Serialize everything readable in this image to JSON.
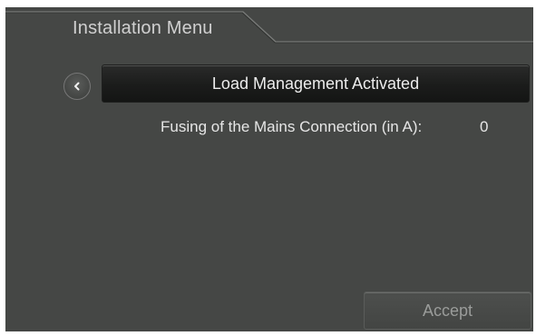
{
  "header": {
    "title": "Installation Menu"
  },
  "nav": {
    "back_icon": "chevron-left-icon"
  },
  "feature": {
    "label": "Load Management Activated"
  },
  "setting": {
    "label": "Fusing of the Mains Connection (in A):",
    "value": "0"
  },
  "actions": {
    "accept_label": "Accept"
  },
  "colors": {
    "background": "#454745",
    "button_dark": "#1b1c1b",
    "text": "#e6e6e6",
    "disabled_text": "#9a9c9a"
  }
}
